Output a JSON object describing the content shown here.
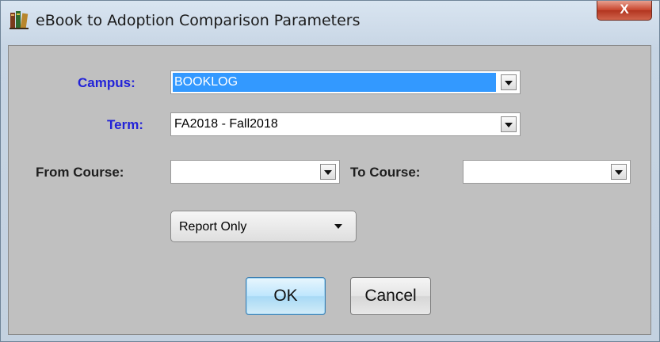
{
  "window": {
    "title": "eBook to Adoption Comparison Parameters",
    "close_glyph": "X"
  },
  "fields": {
    "campus": {
      "label": "Campus:",
      "value": "BOOKLOG"
    },
    "term": {
      "label": "Term:",
      "value": "FA2018 - Fall2018"
    },
    "from_course": {
      "label": "From Course:",
      "value": ""
    },
    "to_course": {
      "label": "To Course:",
      "value": ""
    }
  },
  "report_mode": {
    "value": "Report Only"
  },
  "buttons": {
    "ok": "OK",
    "cancel": "Cancel"
  },
  "colors": {
    "selection": "#3399ff",
    "label_blue": "#2323d8",
    "panel": "#c0c0c0"
  },
  "icons": {
    "app": "books-icon",
    "close": "close-icon",
    "dropdown": "chevron-down-icon"
  }
}
